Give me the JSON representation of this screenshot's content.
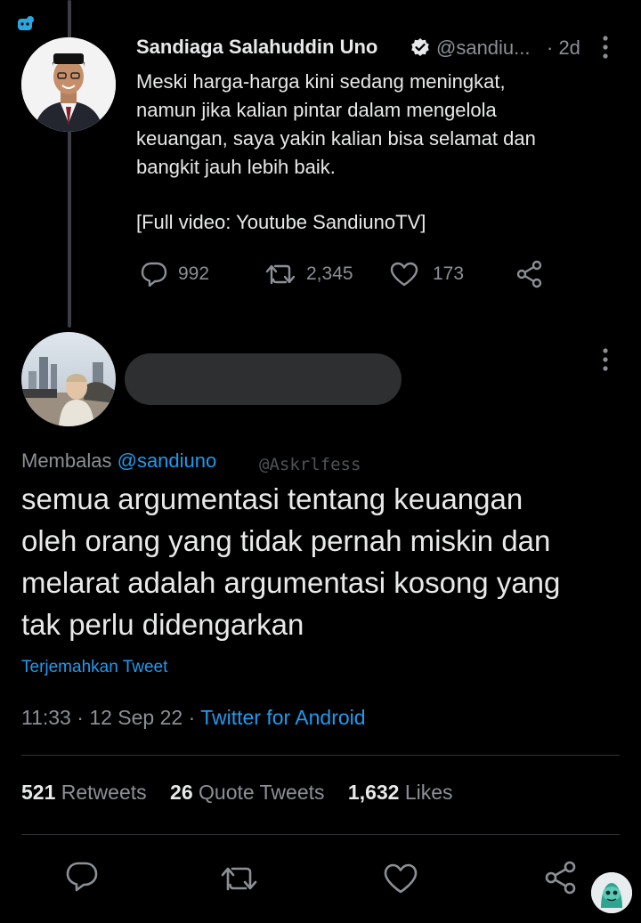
{
  "parent_tweet": {
    "name": "Sandiaga Salahuddin Uno",
    "handle": "@sandiu...",
    "age": "· 2d",
    "lines": [
      "Meski harga-harga kini sedang meningkat,",
      "namun jika kalian pintar dalam mengelola",
      "keuangan, saya yakin kalian bisa selamat dan",
      "bangkit jauh lebih baik."
    ],
    "footer": "[Full video: Youtube SandiunoTV]",
    "replies": "992",
    "retweets": "2,345",
    "likes": "173"
  },
  "reply_tweet": {
    "replying_label": "Membalas",
    "replying_to": "@sandiuno",
    "watermark": "@Askrlfess",
    "lines": [
      "semua argumentasi tentang keuangan",
      "oleh orang yang tidak pernah miskin dan",
      "melarat adalah argumentasi kosong yang",
      "tak perlu didengarkan"
    ],
    "translate": "Terjemahkan Tweet",
    "time": "11:33",
    "date": "12 Sep 22",
    "source": "Twitter for Android"
  },
  "stats": {
    "retweets_count": "521",
    "retweets_label": "Retweets",
    "quotes_count": "26",
    "quotes_label": "Quote Tweets",
    "likes_count": "1,632",
    "likes_label": "Likes"
  },
  "colors": {
    "background": "#000000",
    "text": "#e7e9ea",
    "muted": "#8b9096",
    "link": "#1d9bf0"
  },
  "icons": {
    "top_left": "app-corner-icon",
    "verified": "verified-badge-icon",
    "reply": "reply-icon",
    "retweet": "retweet-icon",
    "like": "heart-icon",
    "share": "share-icon",
    "more": "more-vertical-icon"
  }
}
